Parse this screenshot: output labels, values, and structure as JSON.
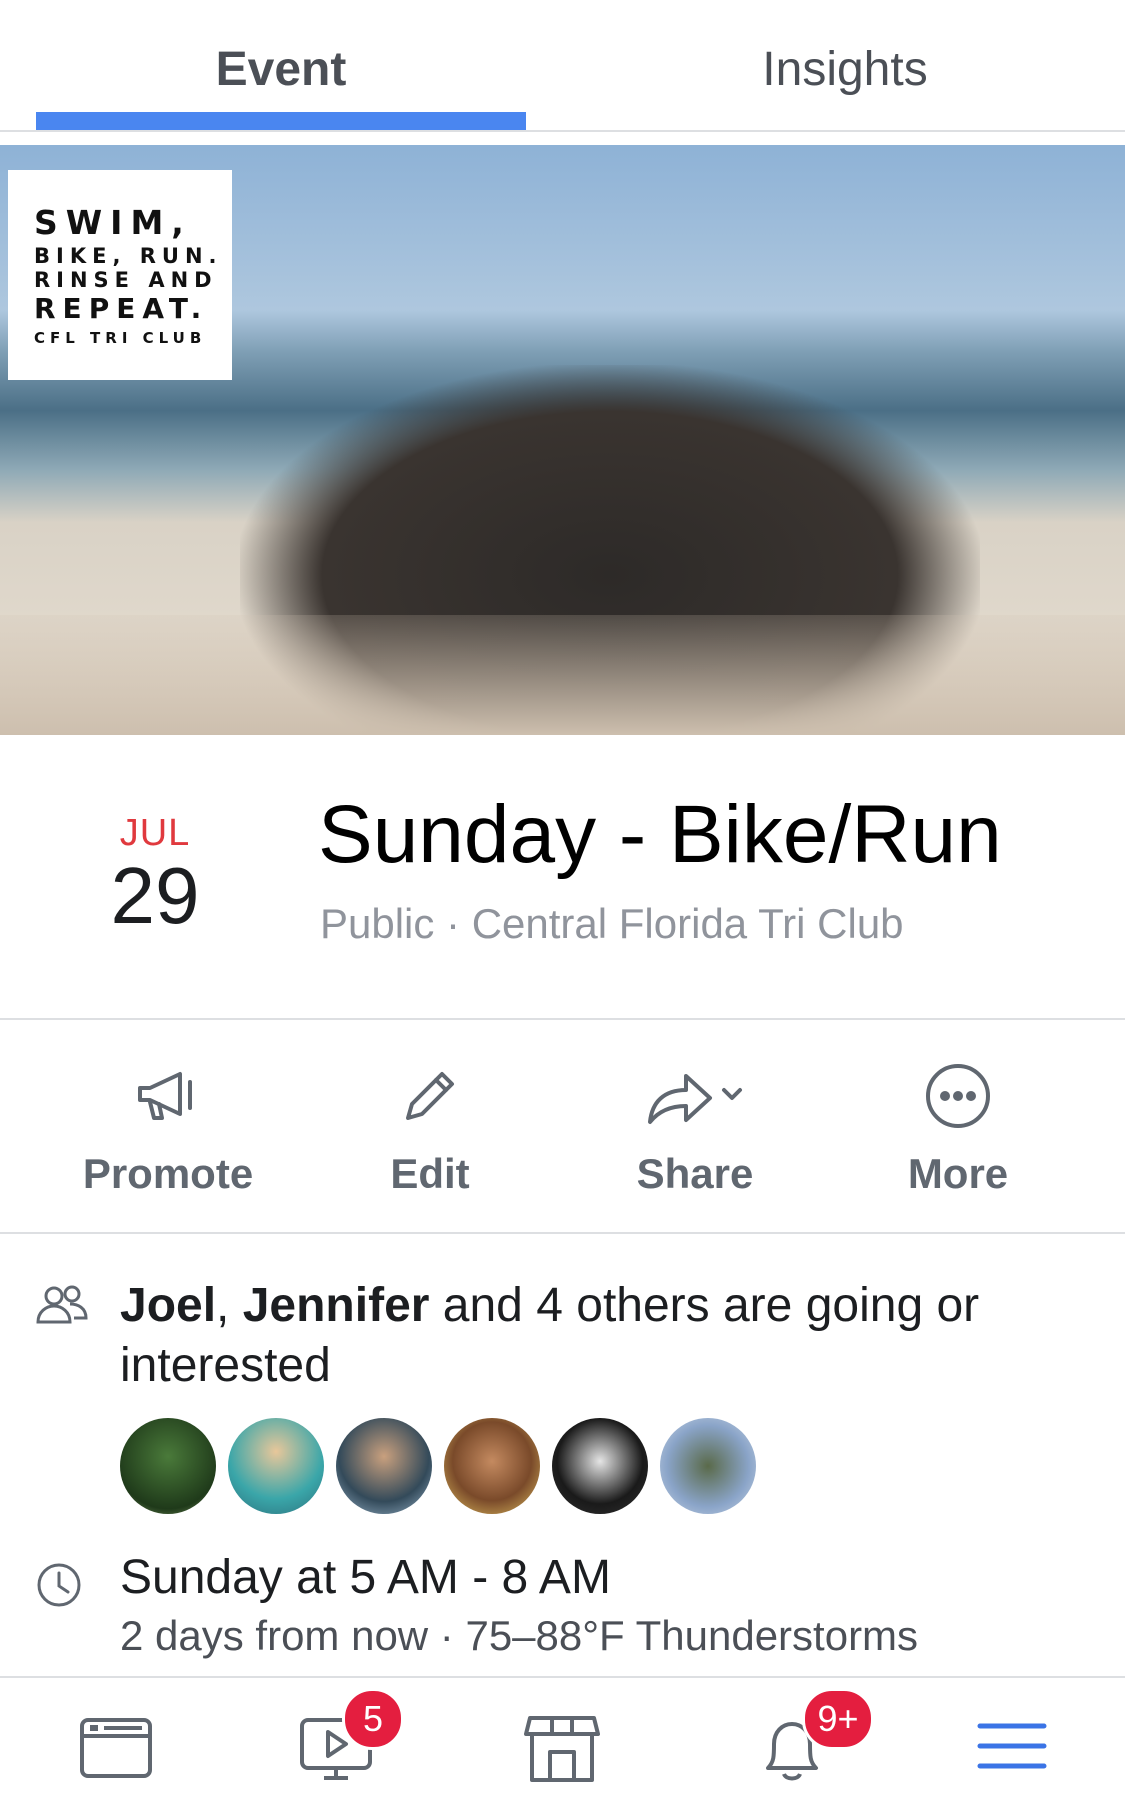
{
  "tabs": {
    "event": "Event",
    "insights": "Insights"
  },
  "cover_logo": {
    "line1": "SWIM,",
    "line2": "BIKE, RUN.",
    "line3": "RINSE AND",
    "line4": "REPEAT.",
    "line5": "CFL TRI CLUB"
  },
  "event": {
    "month": "JUL",
    "day": "29",
    "title": "Sunday - Bike/Run",
    "subtitle": "Public · Central Florida Tri Club"
  },
  "actions": {
    "promote": "Promote",
    "edit": "Edit",
    "share": "Share",
    "more": "More"
  },
  "guests": {
    "name1": "Joel",
    "separator": ", ",
    "name2": "Jennifer",
    "rest": " and 4 others are going or interested"
  },
  "time": {
    "main": "Sunday at 5 AM - 8 AM",
    "sub": "2 days from now · 75–88°F Thunderstorms"
  },
  "bottom_nav": {
    "video_badge": "5",
    "notifications_badge": "9+"
  },
  "colors": {
    "accent": "#4a86f0",
    "month": "#e0393e",
    "badge": "#e41e3f",
    "menu": "#3b74e6"
  },
  "icons": [
    "megaphone-icon",
    "pencil-icon",
    "share-arrow-icon",
    "more-icon",
    "people-icon",
    "clock-icon",
    "news-feed-icon",
    "video-icon",
    "marketplace-icon",
    "bell-icon",
    "menu-icon"
  ]
}
